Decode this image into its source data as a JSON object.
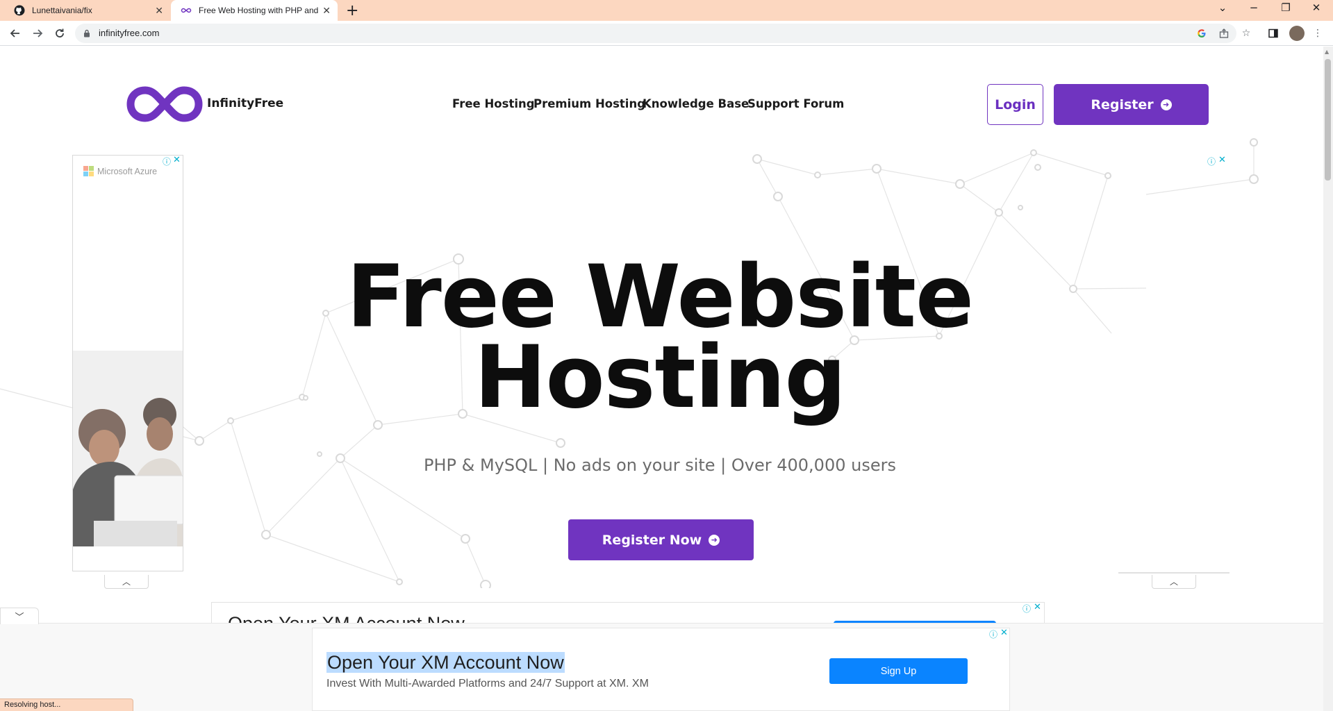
{
  "browser": {
    "tabs": [
      {
        "title": "Lunettaivania/fix",
        "favicon": "github-icon",
        "active": false
      },
      {
        "title": "Free Web Hosting with PHP and",
        "favicon": "infinityfree-icon",
        "active": true
      }
    ],
    "url": "infinityfree.com",
    "status_text": "Resolving host..."
  },
  "header": {
    "logo_text": "InfinityFree",
    "nav": [
      "Free Hosting",
      "Premium Hosting",
      "Knowledge Base",
      "Support Forum"
    ],
    "login_label": "Login",
    "register_label": "Register"
  },
  "hero": {
    "title_line1": "Free Website",
    "title_line2": "Hosting",
    "subtitle": "PHP & MySQL | No ads on your site | Over 400,000 users",
    "cta_label": "Register Now"
  },
  "ads": {
    "left_ad_brand": "Microsoft Azure",
    "mid_ad_title": "Open Your XM Account Now",
    "anchor_ad_title": "Open Your XM Account Now",
    "anchor_ad_desc": "Invest With Multi-Awarded Platforms and 24/7 Support at XM. XM",
    "anchor_ad_button": "Sign Up"
  },
  "colors": {
    "brand_purple": "#7034c0",
    "ad_blue": "#0a84ff",
    "tab_strip": "#fcd7c0"
  }
}
